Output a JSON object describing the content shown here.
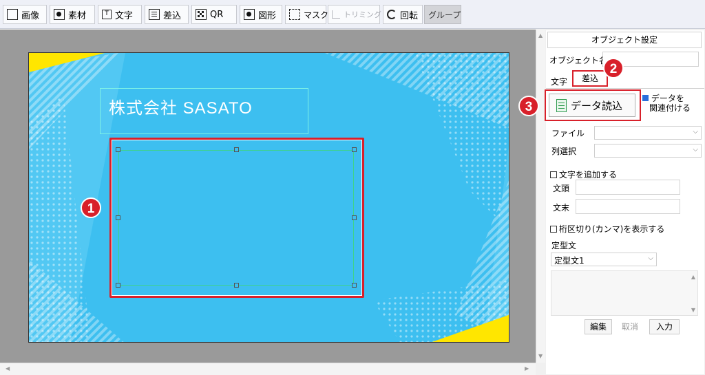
{
  "toolbar": {
    "image_label": "画像",
    "material_label": "素材",
    "text_label": "文字",
    "merge_label": "差込",
    "qr_label": "QR",
    "shape_label": "図形",
    "mask_label": "マスク",
    "trim_label": "トリミング",
    "rotate_label": "回転",
    "group_label": "グループ",
    "text_icon_glyph": "T"
  },
  "card": {
    "company": "株式会社 SASATO"
  },
  "badges": [
    "1",
    "2",
    "3"
  ],
  "panel": {
    "title": "オブジェクト設定",
    "object_name_label": "オブジェクト名",
    "tab_text": "文字",
    "tab_merge": "差込",
    "data_load_button": "データ読込",
    "link_data_line1": "データを",
    "link_data_line2": "関連付ける",
    "file_label": "ファイル",
    "column_label": "列選択",
    "add_text_label": "文字を追加する",
    "prefix_label": "文頭",
    "suffix_label": "文末",
    "separator_label": "桁区切り(カンマ)を表示する",
    "template_label": "定型文",
    "template_value": "定型文1",
    "edit_button": "編集",
    "cancel_button": "取消",
    "input_button": "入力"
  },
  "colors": {
    "card_bg": "#3dbff0",
    "accent_yellow": "#ffe600",
    "selection_red": "#d8202a",
    "text_frame": "#7ff2e6"
  }
}
